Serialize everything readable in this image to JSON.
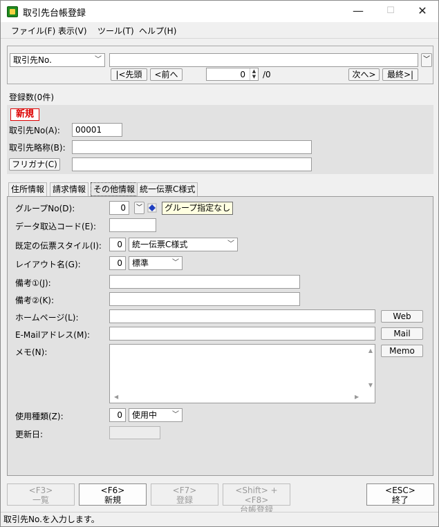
{
  "window": {
    "title": "取引先台帳登録",
    "minimize": "—",
    "maximize": "☐",
    "close": "✕"
  },
  "menu": {
    "items": [
      "ファイル(F)",
      "表示(V)",
      "ツール(T)",
      "ヘルプ(H)"
    ]
  },
  "search": {
    "field_select": "取引先No.",
    "value": "",
    "first_btn": "|<先頭",
    "prev_btn": "<前へ",
    "page_current": "0",
    "page_total": "/0",
    "next_btn": "次へ>",
    "last_btn": "最終>|"
  },
  "count_label": "登録数(0件)",
  "record": {
    "new_badge": "新規",
    "code_label": "取引先No(A):",
    "code_value": "00001",
    "short_name_label": "取引先略称(B):",
    "short_name_value": "",
    "furigana_btn": "フリガナ(C)",
    "furigana_value": ""
  },
  "tabs": [
    "住所情報",
    "請求情報",
    "その他情報",
    "統一伝票C様式"
  ],
  "other": {
    "group_label": "グループNo(D):",
    "group_value": "0",
    "group_tooltip": "グループ指定なし",
    "import_code_label": "データ取込コード(E):",
    "import_code_value": "",
    "slip_style_label": "既定の伝票スタイル(I):",
    "slip_style_num": "0",
    "slip_style_value": "統一伝票C様式",
    "layout_label": "レイアウト名(G):",
    "layout_num": "0",
    "layout_value": "標準",
    "note1_label": "備考①(J):",
    "note1_value": "",
    "note2_label": "備考②(K):",
    "note2_value": "",
    "homepage_label": "ホームページ(L):",
    "homepage_value": "",
    "web_btn": "Web",
    "email_label": "E-Mailアドレス(M):",
    "email_value": "",
    "mail_btn": "Mail",
    "memo_label": "メモ(N):",
    "memo_value": "",
    "memo_btn": "Memo",
    "use_type_label": "使用種類(Z):",
    "use_type_num": "0",
    "use_type_value": "使用中",
    "updated_label": "更新日:",
    "updated_value": ""
  },
  "footer": {
    "btn1_key": "<F3>",
    "btn1_label": "一覧",
    "btn2_key": "<F6>",
    "btn2_label": "新規",
    "btn3_key": "<F7>",
    "btn3_label": "登録",
    "btn4_key": "<Shift> + <F8>",
    "btn4_label": "台帳登録",
    "btn5_key": "<ESC>",
    "btn5_label": "終了"
  },
  "status": "取引先No.を入力します。",
  "colors": {
    "accent_red": "#dd0000",
    "tooltip_bg": "#ffffe1",
    "icon_green": "#1f8a1f"
  }
}
